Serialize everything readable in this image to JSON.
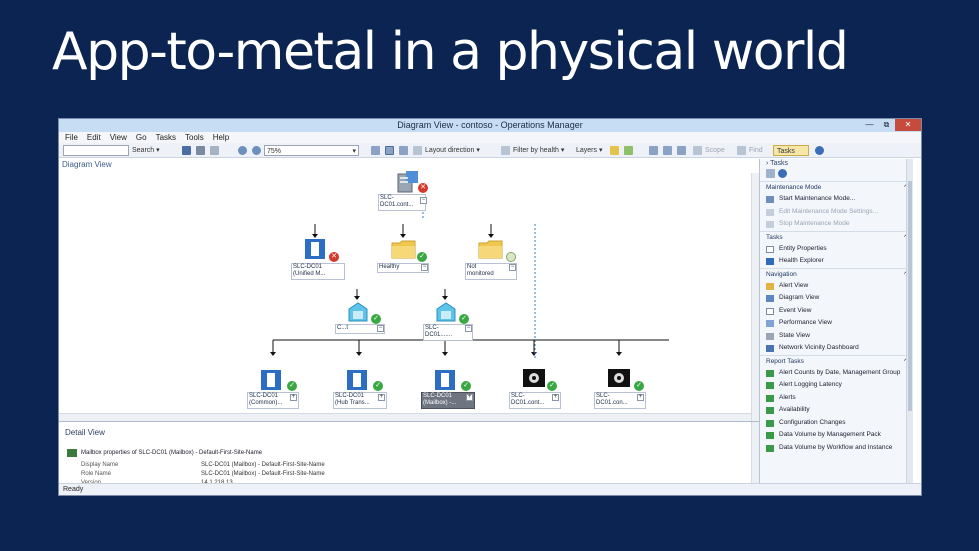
{
  "slide": {
    "title": "App-to-metal in a physical world"
  },
  "window": {
    "title": "Diagram View - contoso - Operations Manager",
    "controls": {
      "minimize": "—",
      "restore": "⧉",
      "close": "✕"
    }
  },
  "menu": [
    "File",
    "Edit",
    "View",
    "Go",
    "Tasks",
    "Tools",
    "Help"
  ],
  "toolbar": {
    "search_label": "Search ▾",
    "zoom_value": "75%",
    "layout_direction": "Layout direction ▾",
    "filter_by_health": "Filter by health ▾",
    "layers": "Layers ▾",
    "scope": "Scope",
    "find": "Find",
    "tasks": "Tasks"
  },
  "diagram": {
    "pane_title": "Diagram View",
    "nodes": [
      {
        "id": "root",
        "label": "SLC-\nDC01.cont...",
        "status": "error"
      },
      {
        "id": "n1",
        "label": "SLC-DC01\n(Unified M...",
        "status": "error"
      },
      {
        "id": "n2",
        "label": "Healthy",
        "status": "ok"
      },
      {
        "id": "n3",
        "label": "Not\nmonitored",
        "status": "warn"
      },
      {
        "id": "n4",
        "label": "C...t",
        "status": "ok"
      },
      {
        "id": "n5",
        "label": "SLC-\nDC01.......",
        "status": "ok"
      },
      {
        "id": "n6",
        "label": "SLC-DC01\n(Common)...",
        "status": "ok"
      },
      {
        "id": "n7",
        "label": "SLC-DC01\n(Hub Trans...",
        "status": "ok"
      },
      {
        "id": "n8",
        "label": "SLC-DC01\n(Mailbox) -...",
        "status": "ok",
        "selected": true
      },
      {
        "id": "n9",
        "label": "SLC-\nDC01.cont...",
        "status": "ok"
      },
      {
        "id": "n10",
        "label": "SLC-\nDC01.con...",
        "status": "ok"
      }
    ]
  },
  "detail": {
    "title": "Detail View",
    "subtitle": "Mailbox properties of SLC-DC01 (Mailbox) - Default-First-Site-Name",
    "rows": [
      {
        "key": "Display Name",
        "value": "SLC-DC01 (Mailbox) - Default-First-Site-Name"
      },
      {
        "key": "Role Name",
        "value": "SLC-DC01 (Mailbox) - Default-First-Site-Name"
      },
      {
        "key": "Version",
        "value": "14.1.218.13"
      }
    ]
  },
  "status_bar": "Ready",
  "tasks": {
    "header": "› Tasks",
    "sections": [
      {
        "title": "Maintenance Mode",
        "items": [
          {
            "label": "Start Maintenance Mode...",
            "enabled": true
          },
          {
            "label": "Edit Maintenance Mode Settings...",
            "enabled": false
          },
          {
            "label": "Stop Maintenance Mode",
            "enabled": false
          }
        ]
      },
      {
        "title": "Tasks",
        "items": [
          {
            "label": "Entity Properties",
            "enabled": true
          },
          {
            "label": "Health Explorer",
            "enabled": true
          }
        ]
      },
      {
        "title": "Navigation",
        "items": [
          {
            "label": "Alert View",
            "enabled": true
          },
          {
            "label": "Diagram View",
            "enabled": true
          },
          {
            "label": "Event View",
            "enabled": true
          },
          {
            "label": "Performance View",
            "enabled": true
          },
          {
            "label": "State View",
            "enabled": true
          },
          {
            "label": "Network Vicinity Dashboard",
            "enabled": true
          }
        ]
      },
      {
        "title": "Report Tasks",
        "items": [
          {
            "label": "Alert Counts by Date, Management Group",
            "enabled": true
          },
          {
            "label": "Alert Logging Latency",
            "enabled": true
          },
          {
            "label": "Alerts",
            "enabled": true
          },
          {
            "label": "Availability",
            "enabled": true
          },
          {
            "label": "Configuration Changes",
            "enabled": true
          },
          {
            "label": "Data Volume by Management Pack",
            "enabled": true
          },
          {
            "label": "Data Volume by Workflow and Instance",
            "enabled": true
          }
        ]
      }
    ]
  },
  "colors": {
    "slide_bg": "#0c2451",
    "ok": "#3aa842",
    "error": "#d23a2c",
    "titlebar": "#c6ddf3"
  }
}
